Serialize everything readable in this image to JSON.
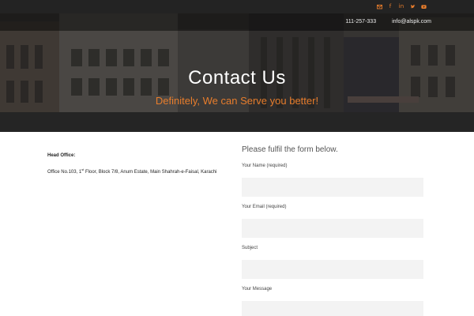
{
  "topbar": {
    "icons": [
      "envelope-icon",
      "facebook-icon",
      "linkedin-icon",
      "twitter-icon",
      "youtube-icon"
    ],
    "accent_color": "#e87d2c"
  },
  "header": {
    "phone": "111-257-333",
    "email": "info@alspk.com"
  },
  "hero": {
    "title": "Contact Us",
    "subtitle": "Definitely, We can Serve you better!"
  },
  "office": {
    "label": "Head Office:",
    "address_prefix": "Office No.103, 1",
    "address_sup": "st",
    "address_suffix": " Floor, Block 7/8, Anum Estate, Main Shahrah-e-Faisal, Karachi"
  },
  "form": {
    "heading": "Please fulfil the form below.",
    "fields": [
      {
        "label": "Your Name (required)",
        "value": ""
      },
      {
        "label": "Your Email (required)",
        "value": ""
      },
      {
        "label": "Subject",
        "value": ""
      },
      {
        "label": "Your Message",
        "value": ""
      }
    ]
  }
}
